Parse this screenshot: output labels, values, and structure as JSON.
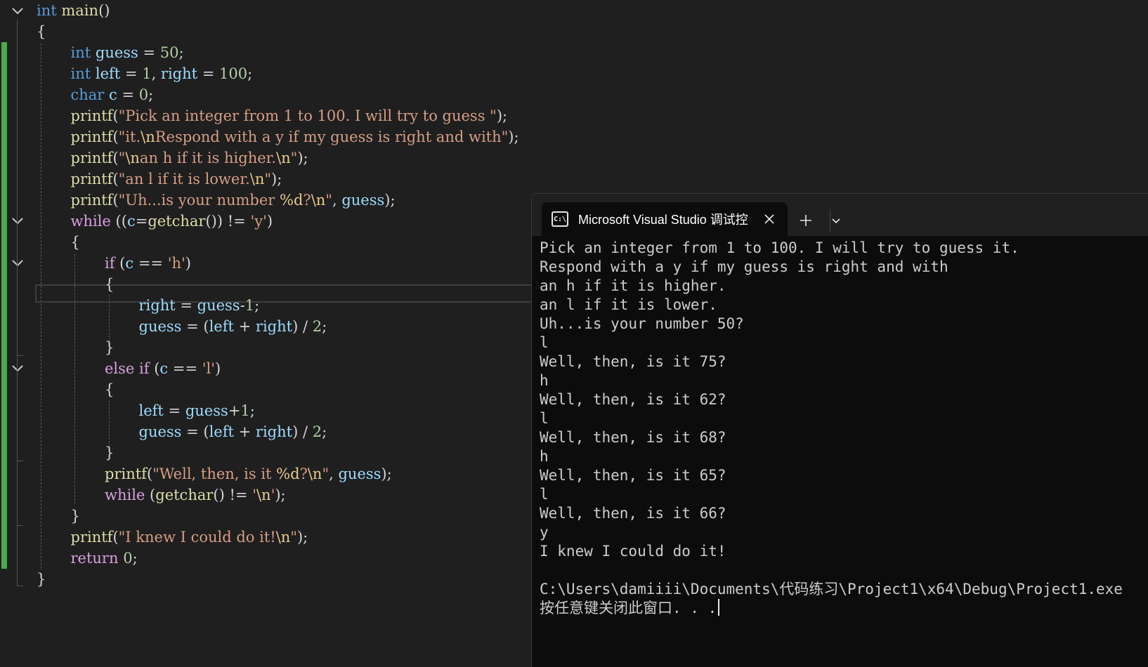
{
  "code": {
    "lines": [
      [
        [
          "kw",
          "int"
        ],
        [
          "pun",
          " "
        ],
        [
          "fn",
          "main"
        ],
        [
          "pun",
          "()"
        ]
      ],
      [
        [
          "pun",
          "{"
        ]
      ],
      [
        [
          "kw",
          "int"
        ],
        [
          "pun",
          " "
        ],
        [
          "var",
          "guess"
        ],
        [
          "pun",
          " = "
        ],
        [
          "num",
          "50"
        ],
        [
          "pun",
          ";"
        ]
      ],
      [
        [
          "kw",
          "int"
        ],
        [
          "pun",
          " "
        ],
        [
          "var",
          "left"
        ],
        [
          "pun",
          " = "
        ],
        [
          "num",
          "1"
        ],
        [
          "pun",
          ", "
        ],
        [
          "var",
          "right"
        ],
        [
          "pun",
          " = "
        ],
        [
          "num",
          "100"
        ],
        [
          "pun",
          ";"
        ]
      ],
      [
        [
          "kw",
          "char"
        ],
        [
          "pun",
          " "
        ],
        [
          "var",
          "c"
        ],
        [
          "pun",
          " = "
        ],
        [
          "num",
          "0"
        ],
        [
          "pun",
          ";"
        ]
      ],
      [
        [
          "fn",
          "printf"
        ],
        [
          "pun",
          "("
        ],
        [
          "str",
          "\"Pick an integer from 1 to 100. I will try to guess \""
        ],
        [
          "pun",
          ");"
        ]
      ],
      [
        [
          "fn",
          "printf"
        ],
        [
          "pun",
          "("
        ],
        [
          "str",
          "\"it."
        ],
        [
          "esc",
          "\\n"
        ],
        [
          "str",
          "Respond with a y if my guess is right and with\""
        ],
        [
          "pun",
          ");"
        ]
      ],
      [
        [
          "fn",
          "printf"
        ],
        [
          "pun",
          "("
        ],
        [
          "str",
          "\""
        ],
        [
          "esc",
          "\\n"
        ],
        [
          "str",
          "an h if it is higher."
        ],
        [
          "esc",
          "\\n"
        ],
        [
          "str",
          "\""
        ],
        [
          "pun",
          ");"
        ]
      ],
      [
        [
          "fn",
          "printf"
        ],
        [
          "pun",
          "("
        ],
        [
          "str",
          "\"an l if it is lower."
        ],
        [
          "esc",
          "\\n"
        ],
        [
          "str",
          "\""
        ],
        [
          "pun",
          ");"
        ]
      ],
      [
        [
          "fn",
          "printf"
        ],
        [
          "pun",
          "("
        ],
        [
          "str",
          "\"Uh...is your number "
        ],
        [
          "esc",
          "%d"
        ],
        [
          "str",
          "?"
        ],
        [
          "esc",
          "\\n"
        ],
        [
          "str",
          "\""
        ],
        [
          "pun",
          ", "
        ],
        [
          "var",
          "guess"
        ],
        [
          "pun",
          ");"
        ]
      ],
      [
        [
          "ctl",
          "while"
        ],
        [
          "pun",
          " (("
        ],
        [
          "var",
          "c"
        ],
        [
          "pun",
          "="
        ],
        [
          "fn",
          "getchar"
        ],
        [
          "pun",
          "()) != "
        ],
        [
          "str",
          "'y'"
        ],
        [
          "pun",
          ")"
        ]
      ],
      [
        [
          "pun",
          "{"
        ]
      ],
      [
        [
          "ctl",
          "if"
        ],
        [
          "pun",
          " ("
        ],
        [
          "var",
          "c"
        ],
        [
          "pun",
          " == "
        ],
        [
          "str",
          "'h'"
        ],
        [
          "pun",
          ")"
        ]
      ],
      [
        [
          "pun",
          "{"
        ]
      ],
      [
        [
          "var",
          "right"
        ],
        [
          "pun",
          " = "
        ],
        [
          "var",
          "guess"
        ],
        [
          "pun",
          "-"
        ],
        [
          "num",
          "1"
        ],
        [
          "pun",
          ";"
        ]
      ],
      [
        [
          "var",
          "guess"
        ],
        [
          "pun",
          " = ("
        ],
        [
          "var",
          "left"
        ],
        [
          "pun",
          " + "
        ],
        [
          "var",
          "right"
        ],
        [
          "pun",
          ") / "
        ],
        [
          "num",
          "2"
        ],
        [
          "pun",
          ";"
        ]
      ],
      [
        [
          "pun",
          "}"
        ]
      ],
      [
        [
          "ctl",
          "else"
        ],
        [
          "pun",
          " "
        ],
        [
          "ctl",
          "if"
        ],
        [
          "pun",
          " ("
        ],
        [
          "var",
          "c"
        ],
        [
          "pun",
          " == "
        ],
        [
          "str",
          "'l'"
        ],
        [
          "pun",
          ")"
        ]
      ],
      [
        [
          "pun",
          "{"
        ]
      ],
      [
        [
          "var",
          "left"
        ],
        [
          "pun",
          " = "
        ],
        [
          "var",
          "guess"
        ],
        [
          "pun",
          "+"
        ],
        [
          "num",
          "1"
        ],
        [
          "pun",
          ";"
        ]
      ],
      [
        [
          "var",
          "guess"
        ],
        [
          "pun",
          " = ("
        ],
        [
          "var",
          "left"
        ],
        [
          "pun",
          " + "
        ],
        [
          "var",
          "right"
        ],
        [
          "pun",
          ") / "
        ],
        [
          "num",
          "2"
        ],
        [
          "pun",
          ";"
        ]
      ],
      [
        [
          "pun",
          "}"
        ]
      ],
      [
        [
          "fn",
          "printf"
        ],
        [
          "pun",
          "("
        ],
        [
          "str",
          "\"Well, then, is it "
        ],
        [
          "esc",
          "%d"
        ],
        [
          "str",
          "?"
        ],
        [
          "esc",
          "\\n"
        ],
        [
          "str",
          "\""
        ],
        [
          "pun",
          ", "
        ],
        [
          "var",
          "guess"
        ],
        [
          "pun",
          ");"
        ]
      ],
      [
        [
          "ctl",
          "while"
        ],
        [
          "pun",
          " ("
        ],
        [
          "fn",
          "getchar"
        ],
        [
          "pun",
          "() != "
        ],
        [
          "str",
          "'"
        ],
        [
          "esc",
          "\\n"
        ],
        [
          "str",
          "'"
        ],
        [
          "pun",
          ");"
        ]
      ],
      [
        [
          "pun",
          "}"
        ]
      ],
      [
        [
          "fn",
          "printf"
        ],
        [
          "pun",
          "("
        ],
        [
          "str",
          "\"I knew I could do it!"
        ],
        [
          "esc",
          "\\n"
        ],
        [
          "str",
          "\""
        ],
        [
          "pun",
          ");"
        ]
      ],
      [
        [
          "ctl",
          "return"
        ],
        [
          "pun",
          " "
        ],
        [
          "num",
          "0"
        ],
        [
          "pun",
          ";"
        ]
      ],
      [
        [
          "pun",
          "}"
        ]
      ]
    ]
  },
  "terminal": {
    "tab_title": "Microsoft Visual Studio 调试控",
    "tab_icon_text": "C:\\",
    "output": [
      "Pick an integer from 1 to 100. I will try to guess it.",
      "Respond with a y if my guess is right and with",
      "an h if it is higher.",
      "an l if it is lower.",
      "Uh...is your number 50?",
      "l",
      "Well, then, is it 75?",
      "h",
      "Well, then, is it 62?",
      "l",
      "Well, then, is it 68?",
      "h",
      "Well, then, is it 65?",
      "l",
      "Well, then, is it 66?",
      "y",
      "I knew I could do it!",
      "",
      "C:\\Users\\damiiii\\Documents\\代码练习\\Project1\\x64\\Debug\\Project1.exe",
      "按任意键关闭此窗口. . ."
    ]
  },
  "icons": {
    "fold": "chevron-down-icon",
    "close": "close-icon",
    "new_tab": "plus-icon",
    "dropdown": "chevron-down-icon",
    "console": "console-icon"
  },
  "colors": {
    "editor_bg": "#1f1f1f",
    "terminal_bg": "#0c0c0c",
    "change_bar": "#4ea94b"
  }
}
